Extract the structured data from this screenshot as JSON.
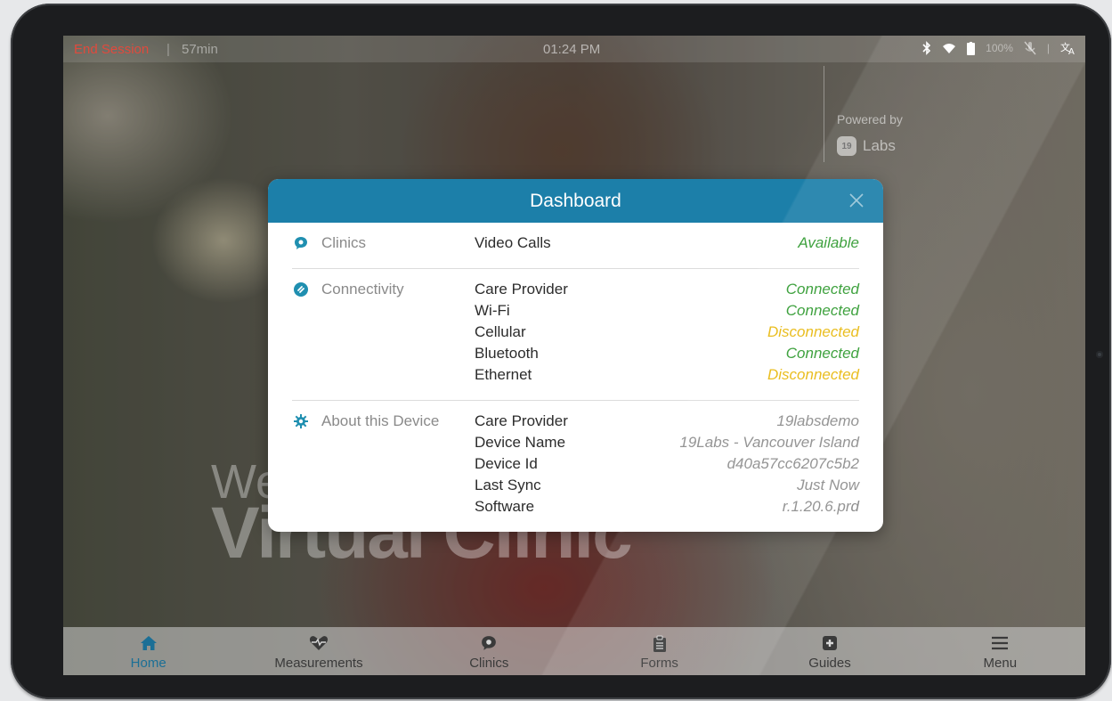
{
  "status_bar": {
    "end_session": "End Session",
    "separator": "|",
    "timer": "57min",
    "clock": "01:24 PM",
    "battery": "100%"
  },
  "background": {
    "powered_by": "Powered by",
    "brand": "Labs",
    "brand_badge": "19",
    "welcome_partial": "We",
    "title_partial": "Virtual Clinic"
  },
  "dashboard": {
    "title": "Dashboard",
    "sections": [
      {
        "icon": "chat-bubble-icon",
        "label": "Clinics",
        "rows": [
          {
            "key": "Video Calls",
            "value": "Available",
            "status": "ok"
          }
        ]
      },
      {
        "icon": "link-icon",
        "label": "Connectivity",
        "rows": [
          {
            "key": "Care Provider",
            "value": "Connected",
            "status": "ok"
          },
          {
            "key": "Wi-Fi",
            "value": "Connected",
            "status": "ok"
          },
          {
            "key": "Cellular",
            "value": "Disconnected",
            "status": "warn"
          },
          {
            "key": "Bluetooth",
            "value": "Connected",
            "status": "ok"
          },
          {
            "key": "Ethernet",
            "value": "Disconnected",
            "status": "warn"
          }
        ]
      },
      {
        "icon": "gear-icon",
        "label": "About this Device",
        "rows": [
          {
            "key": "Care Provider",
            "value": "19labsdemo",
            "status": "info"
          },
          {
            "key": "Device Name",
            "value": "19Labs - Vancouver Island",
            "status": "info"
          },
          {
            "key": "Device Id",
            "value": "d40a57cc6207c5b2",
            "status": "info"
          },
          {
            "key": "Last Sync",
            "value": "Just Now",
            "status": "info"
          },
          {
            "key": "Software",
            "value": "r.1.20.6.prd",
            "status": "info"
          }
        ]
      }
    ]
  },
  "nav": {
    "items": [
      {
        "label": "Home",
        "icon": "home-icon",
        "active": true
      },
      {
        "label": "Measurements",
        "icon": "heart-pulse-icon",
        "active": false
      },
      {
        "label": "Clinics",
        "icon": "chat-bubble-icon",
        "active": false
      },
      {
        "label": "Forms",
        "icon": "clipboard-icon",
        "active": false
      },
      {
        "label": "Guides",
        "icon": "first-aid-icon",
        "active": false
      },
      {
        "label": "Menu",
        "icon": "hamburger-icon",
        "active": false
      }
    ]
  },
  "colors": {
    "header": "#1c7fa9",
    "ok": "#2f9a2f",
    "warn": "#e8b80d",
    "active_nav": "#1b6f96",
    "end_session": "#e04a3d"
  }
}
